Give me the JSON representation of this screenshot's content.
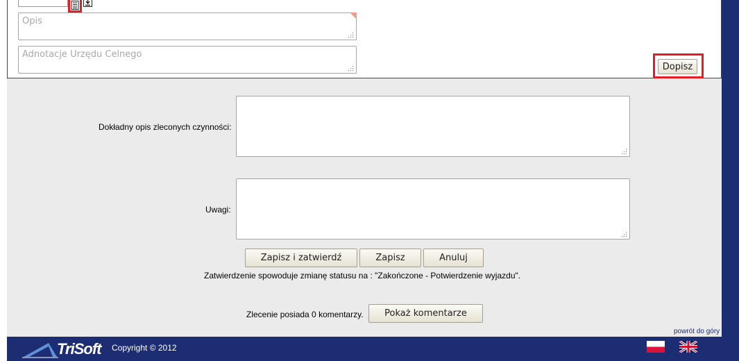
{
  "top_panel": {
    "opis_placeholder": "Opis",
    "adnotacje_placeholder": "Adnotacje Urzędu Celnego",
    "dopisz_label": "Dopisz"
  },
  "form": {
    "opis_czynnosci_label": "Dokładny opis zleconych czynności:",
    "opis_czynnosci_value": "",
    "uwagi_label": "Uwagi:",
    "uwagi_value": ""
  },
  "actions": {
    "save_confirm_label": "Zapisz i zatwierdź",
    "save_label": "Zapisz",
    "cancel_label": "Anuluj",
    "status_note": "Zatwierdzenie spowoduje zmianę statusu na : \"Zakończone - Potwierdzenie wyjazdu\"."
  },
  "comments": {
    "text": "Zlecenie posiada 0 komentarzy.",
    "show_label": "Pokaż komentarze"
  },
  "back_to_top": "powrót do góry",
  "footer": {
    "logo_text": "TriSoft",
    "copyright": "Copyright © 2012",
    "languages": [
      "pl",
      "en"
    ]
  },
  "colors": {
    "brand_navy": "#1c2d73",
    "highlight_red": "#e21d24",
    "content_bg": "#ebebeb"
  },
  "icons": [
    "document-icon",
    "download-icon",
    "resize-grip-icon",
    "trisoft-logo-icon",
    "flag-pl-icon",
    "flag-uk-icon"
  ]
}
